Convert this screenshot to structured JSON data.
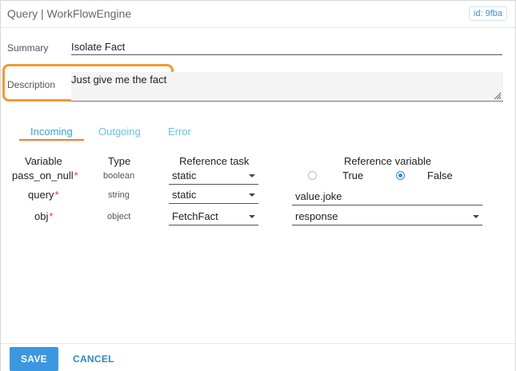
{
  "window": {
    "title": "Query | WorkFlowEngine",
    "id_badge": "id: 9fba"
  },
  "form": {
    "summary_label": "Summary",
    "summary_value": "Isolate Fact",
    "description_label": "Description",
    "description_value": "Just give me the fact"
  },
  "tabs": [
    {
      "label": "Incoming",
      "active": true
    },
    {
      "label": "Outgoing",
      "active": false
    },
    {
      "label": "Error",
      "active": false
    }
  ],
  "table": {
    "headers": {
      "variable": "Variable",
      "type": "Type",
      "reference_task": "Reference task",
      "reference_variable": "Reference variable"
    },
    "required_marker": "*",
    "rows": [
      {
        "variable": "pass_on_null",
        "type": "boolean",
        "reference_task": "static",
        "reference_variable": {
          "kind": "radio",
          "options": [
            "True",
            "False"
          ],
          "selected": "False"
        }
      },
      {
        "variable": "query",
        "type": "string",
        "reference_task": "static",
        "reference_variable": {
          "kind": "text",
          "value": "value.joke"
        }
      },
      {
        "variable": "obj",
        "type": "object",
        "reference_task": "FetchFact",
        "reference_variable": {
          "kind": "select",
          "value": "response"
        }
      }
    ]
  },
  "footer": {
    "save_label": "SAVE",
    "cancel_label": "CANCEL"
  },
  "colors": {
    "accent": "#3b97e0",
    "active_tab_underline": "#f07a3c",
    "highlight_box": "#f39a2c",
    "required": "#e53935"
  }
}
